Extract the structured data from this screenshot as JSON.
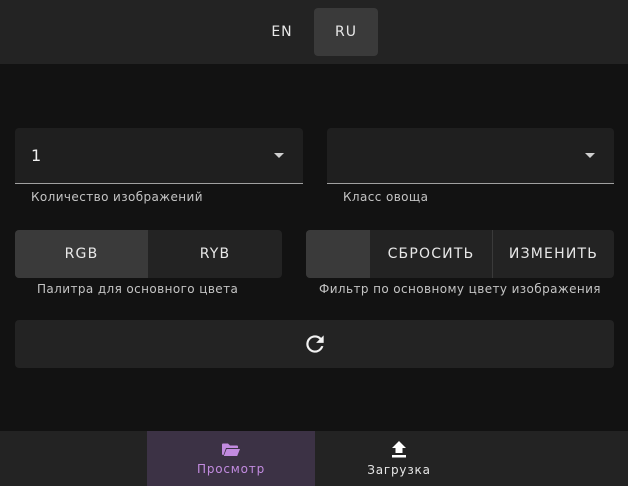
{
  "header": {
    "languages": [
      {
        "label": "EN",
        "active": false
      },
      {
        "label": "RU",
        "active": true
      }
    ]
  },
  "filters": {
    "image_count": {
      "value": "1",
      "helper": "Количество изображений"
    },
    "vegetable_class": {
      "value": "",
      "helper": "Класс овоща"
    }
  },
  "palette": {
    "options": [
      "RGB",
      "RYB"
    ],
    "selected": "RGB",
    "helper": "Палитра для основного цвета"
  },
  "color_filter": {
    "reset_label": "СБРОСИТЬ",
    "change_label": "ИЗМЕНИТЬ",
    "helper": "Фильтр по основному цвету изображения"
  },
  "refresh": {
    "icon": "refresh-icon"
  },
  "bottom_nav": {
    "items": [
      {
        "label": "Просмотр",
        "icon": "folder-open-icon",
        "active": true
      },
      {
        "label": "Загрузка",
        "icon": "upload-icon",
        "active": false
      }
    ]
  },
  "colors": {
    "accent": "#c28be0",
    "active_nav_bg": "#3c3245"
  }
}
